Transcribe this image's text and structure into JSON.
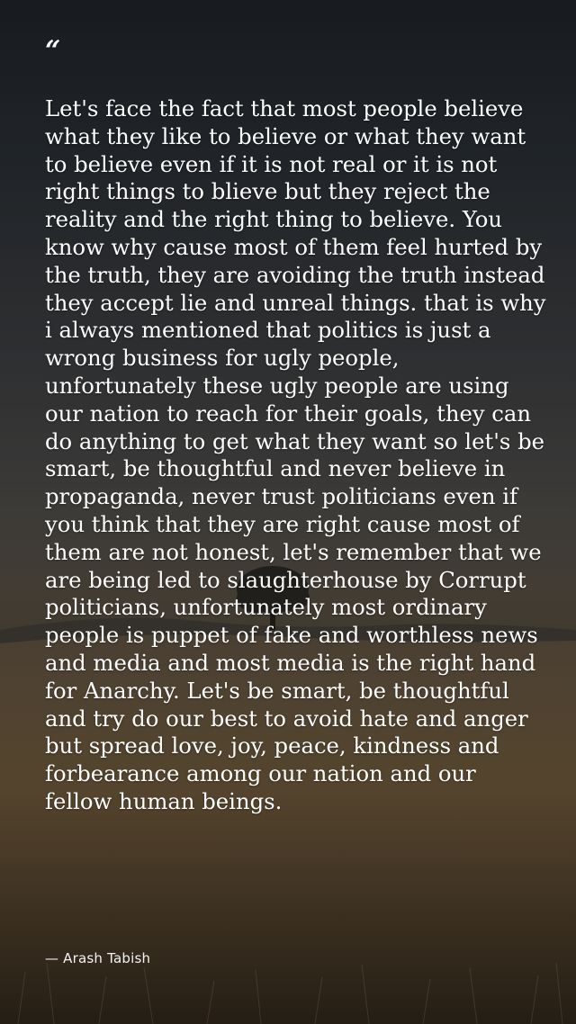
{
  "quote": {
    "mark": "“",
    "text": "Let's face the fact that most people believe what they like to believe or what they want to believe even if it is not real or it is not right things to blieve but they reject the reality and the right thing to believe. You know why cause most of them feel hurted by the truth, they are avoiding the truth instead they accept lie and unreal things. that is why i always mentioned that politics is just a wrong business for ugly people, unfortunately these ugly people are using our nation to reach for their goals, they can do anything to get what they want so let's be smart, be thoughtful and never believe in propaganda, never trust politicians even if you think that they are right cause most of them are not honest, let's remember that we are being led to slaughterhouse by Corrupt politicians, unfortunately most ordinary people is puppet of fake and worthless news and media and most media is the right hand for Anarchy. Let's be smart, be thoughtful and try do our best to avoid hate and anger but spread love, joy, peace, kindness and forbearance among our nation and our fellow human beings.",
    "author": "— Arash Tabish"
  },
  "colors": {
    "text": "#ffffff",
    "sky": "#2a2e33",
    "field": "#5a4a35"
  }
}
